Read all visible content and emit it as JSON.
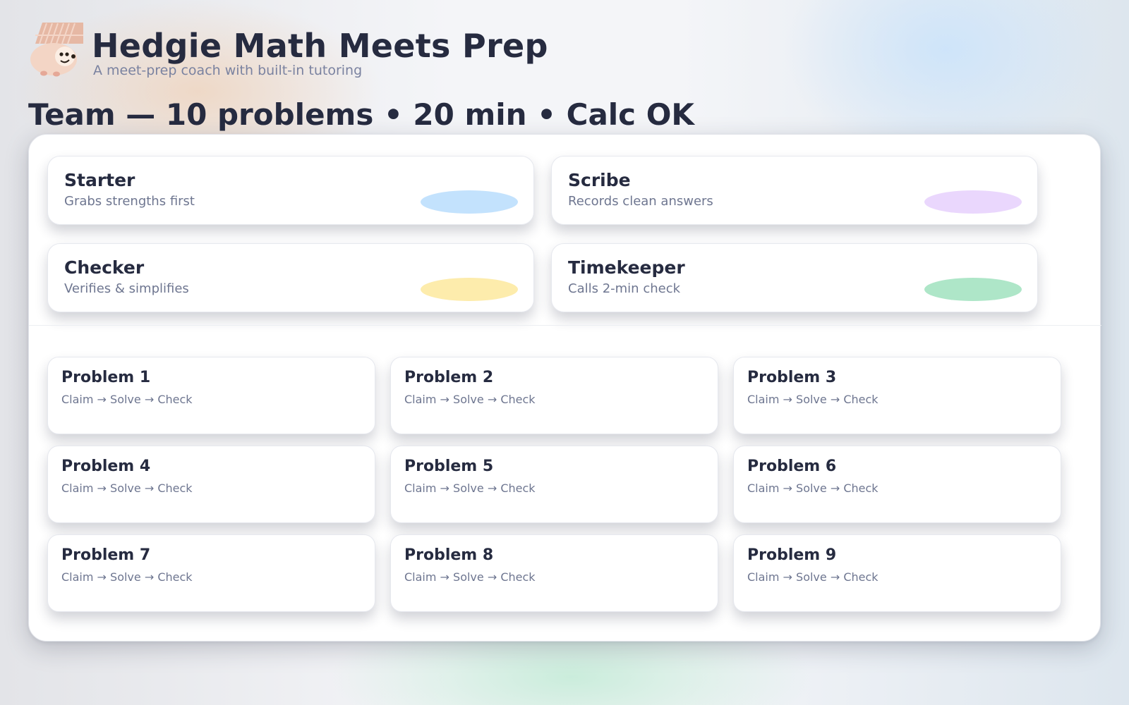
{
  "app": {
    "title": "Hedgie Math Meets Prep",
    "subtitle": "A meet-prep coach with built-in tutoring",
    "logo_icon": "hedgehog-icon"
  },
  "session": {
    "heading": "Team — 10 problems • 20 min • Calc OK"
  },
  "roles": [
    {
      "name": "Starter",
      "description": "Grabs strengths first",
      "color": "#c3e2fd"
    },
    {
      "name": "Scribe",
      "description": "Records clean answers",
      "color": "#ead7fd"
    },
    {
      "name": "Checker",
      "description": "Verifies & simplifies",
      "color": "#fdecac"
    },
    {
      "name": "Timekeeper",
      "description": "Calls 2-min check",
      "color": "#aee6c8"
    }
  ],
  "problems": [
    {
      "title": "Problem 1",
      "steps": "Claim → Solve → Check"
    },
    {
      "title": "Problem 2",
      "steps": "Claim → Solve → Check"
    },
    {
      "title": "Problem 3",
      "steps": "Claim → Solve → Check"
    },
    {
      "title": "Problem 4",
      "steps": "Claim → Solve → Check"
    },
    {
      "title": "Problem 5",
      "steps": "Claim → Solve → Check"
    },
    {
      "title": "Problem 6",
      "steps": "Claim → Solve → Check"
    },
    {
      "title": "Problem 7",
      "steps": "Claim → Solve → Check"
    },
    {
      "title": "Problem 8",
      "steps": "Claim → Solve → Check"
    },
    {
      "title": "Problem 9",
      "steps": "Claim → Solve → Check"
    }
  ],
  "colors": {
    "text_primary": "#262b40",
    "text_secondary": "#6e7690",
    "panel": "#ffffff"
  }
}
